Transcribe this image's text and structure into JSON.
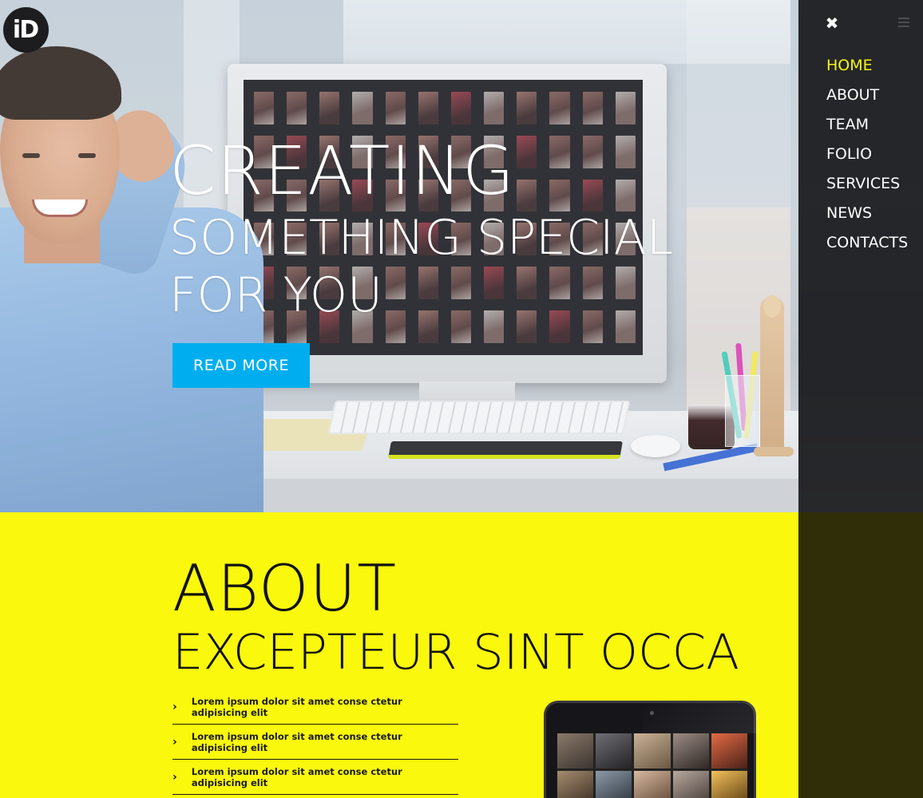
{
  "logo": {
    "letter_i": "i",
    "letter_d": "D"
  },
  "hero": {
    "line_1": "CREATING",
    "line_2": "SOMETHING SPECIAL",
    "line_3": "FOR YOU",
    "cta_label": "READ MORE"
  },
  "nav": {
    "close_icon": "close-icon",
    "menu_icon": "menu-icon",
    "items": [
      {
        "label": "HOME",
        "active": true
      },
      {
        "label": "ABOUT",
        "active": false
      },
      {
        "label": "TEAM",
        "active": false
      },
      {
        "label": "FOLIO",
        "active": false
      },
      {
        "label": "SERVICES",
        "active": false
      },
      {
        "label": "NEWS",
        "active": false
      },
      {
        "label": "CONTACTS",
        "active": false
      }
    ]
  },
  "about": {
    "title": "ABOUT",
    "subtitle": "EXCEPTEUR SINT OCCA",
    "list": [
      {
        "icon": "chevron-right-icon",
        "text": "Lorem ipsum dolor sit amet conse ctetur adipisicing elit"
      },
      {
        "icon": "chevron-right-icon",
        "text": "Lorem ipsum dolor sit amet conse ctetur adipisicing elit"
      },
      {
        "icon": "chevron-right-icon",
        "text": "Lorem ipsum dolor sit amet conse ctetur adipisicing elit"
      }
    ]
  },
  "colors": {
    "accent_yellow": "#faf80c",
    "button_blue": "#00aeef",
    "nav_active": "#f7f513",
    "nav_background": "#0f0f11"
  }
}
